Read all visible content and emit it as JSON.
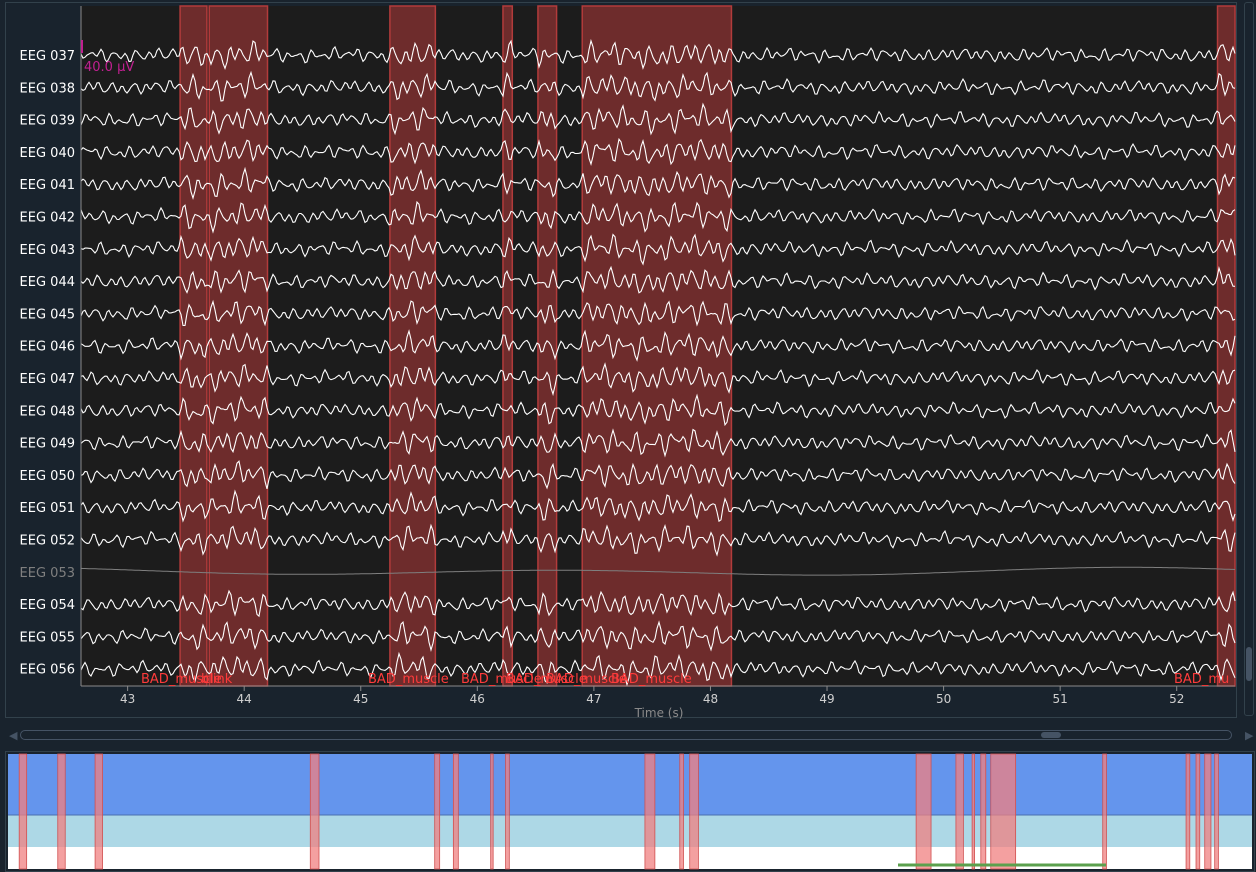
{
  "plot": {
    "channels": [
      "EEG 037",
      "EEG 038",
      "EEG 039",
      "EEG 040",
      "EEG 041",
      "EEG 042",
      "EEG 043",
      "EEG 044",
      "EEG 045",
      "EEG 046",
      "EEG 047",
      "EEG 048",
      "EEG 049",
      "EEG 050",
      "EEG 051",
      "EEG 052",
      "EEG 053",
      "EEG 054",
      "EEG 055",
      "EEG 056"
    ],
    "bad_channels": [
      "EEG 053"
    ],
    "xticks": [
      "43",
      "44",
      "45",
      "46",
      "47",
      "48",
      "49",
      "50",
      "51",
      "52"
    ],
    "xlabel": "Time (s)",
    "scale_label": "40.0 µV",
    "annotation_labels": [
      "BAD_muscle",
      "blink",
      "BAD_muscle",
      "BAD_muscle",
      "BAD_muscle",
      "BAD_muscle",
      "BAD_muscle",
      "BAD_mu"
    ],
    "time_start": 42.6,
    "time_end": 52.5,
    "annotations": [
      {
        "start": 43.45,
        "end": 43.68
      },
      {
        "start": 43.7,
        "end": 44.2
      },
      {
        "start": 45.25,
        "end": 45.64
      },
      {
        "start": 46.22,
        "end": 46.3
      },
      {
        "start": 46.52,
        "end": 46.68
      },
      {
        "start": 46.9,
        "end": 48.18
      },
      {
        "start": 52.35,
        "end": 52.5
      }
    ]
  },
  "overview": {
    "spans": [
      [
        0.009,
        0.015
      ],
      [
        0.04,
        0.046
      ],
      [
        0.07,
        0.076
      ],
      [
        0.243,
        0.25
      ],
      [
        0.343,
        0.347
      ],
      [
        0.358,
        0.362
      ],
      [
        0.388,
        0.39
      ],
      [
        0.4,
        0.403
      ],
      [
        0.512,
        0.52
      ],
      [
        0.54,
        0.543
      ],
      [
        0.548,
        0.555
      ],
      [
        0.73,
        0.742
      ],
      [
        0.762,
        0.768
      ],
      [
        0.775,
        0.777
      ],
      [
        0.782,
        0.786
      ],
      [
        0.79,
        0.81
      ],
      [
        0.88,
        0.883
      ],
      [
        0.947,
        0.95
      ],
      [
        0.955,
        0.958
      ],
      [
        0.962,
        0.967
      ],
      [
        0.97,
        0.973
      ]
    ]
  },
  "colors": {
    "background": "#19232d",
    "plot_bg": "#1c1c1c",
    "trace": "#ffffff",
    "bad_trace": "#7f7f7f",
    "annotation_fill": "#b23b3b",
    "annotation_text": "#ff3b3b",
    "overview_top": "#6495ed",
    "overview_mid": "#add8e6",
    "overview_bottom": "#ffffff",
    "overview_span": "#f08080",
    "view_marker": "#5ba04d",
    "scale_bar": "#c02090"
  }
}
